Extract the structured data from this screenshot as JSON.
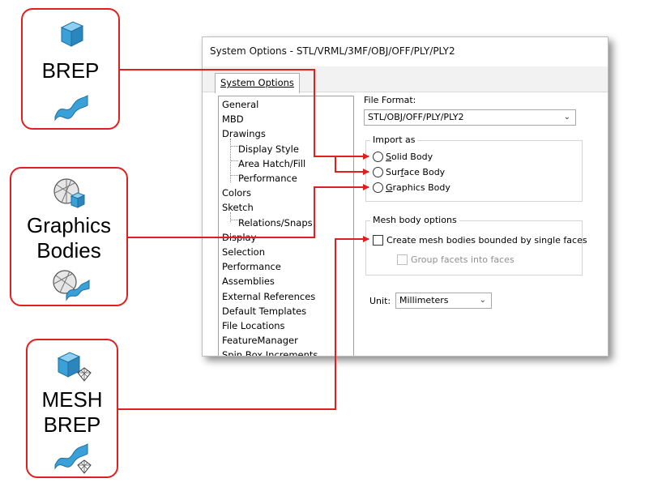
{
  "callouts": {
    "brep": {
      "label": "BREP"
    },
    "graphics": {
      "line1": "Graphics",
      "line2": "Bodies"
    },
    "mesh": {
      "line1": "MESH",
      "line2": "BREP"
    }
  },
  "dialog": {
    "title": "System Options - STL/VRML/3MF/OBJ/OFF/PLY/PLY2",
    "tab_label": "System Options",
    "tree": [
      {
        "label": "General",
        "child": false
      },
      {
        "label": "MBD",
        "child": false
      },
      {
        "label": "Drawings",
        "child": false
      },
      {
        "label": "Display Style",
        "child": true
      },
      {
        "label": "Area Hatch/Fill",
        "child": true
      },
      {
        "label": "Performance",
        "child": true
      },
      {
        "label": "Colors",
        "child": false
      },
      {
        "label": "Sketch",
        "child": false
      },
      {
        "label": "Relations/Snaps",
        "child": true
      },
      {
        "label": "Display",
        "child": false
      },
      {
        "label": "Selection",
        "child": false
      },
      {
        "label": "Performance",
        "child": false
      },
      {
        "label": "Assemblies",
        "child": false
      },
      {
        "label": "External References",
        "child": false
      },
      {
        "label": "Default Templates",
        "child": false
      },
      {
        "label": "File Locations",
        "child": false
      },
      {
        "label": "FeatureManager",
        "child": false
      },
      {
        "label": "Spin Box Increments",
        "child": false
      }
    ],
    "file_format": {
      "label": "File Format:",
      "value": "STL/OBJ/OFF/PLY/PLY2"
    },
    "import_as": {
      "title": "Import as",
      "options": [
        {
          "label": "Solid Body",
          "mnemonic": "S",
          "selected": false
        },
        {
          "label": "Surface Body",
          "mnemonic": "f",
          "selected": false
        },
        {
          "label": "Graphics Body",
          "mnemonic": "G",
          "selected": false
        }
      ]
    },
    "mesh_options": {
      "title": "Mesh body options",
      "create_bounded": {
        "label": "Create mesh bodies bounded by single faces",
        "checked": false
      },
      "group_facets": {
        "label": "Group facets into faces",
        "checked": false,
        "enabled": false
      }
    },
    "unit": {
      "label": "Unit:",
      "value": "Millimeters"
    }
  },
  "colors": {
    "callout_border": "#e02020",
    "arrow": "#e02020",
    "icon_blue": "#3aa0d8"
  },
  "icons": [
    "solid-cube-icon",
    "surface-icon",
    "graphics-sphere-cube-icon",
    "graphics-sphere-surface-icon",
    "mesh-cube-icon",
    "mesh-surface-icon"
  ]
}
